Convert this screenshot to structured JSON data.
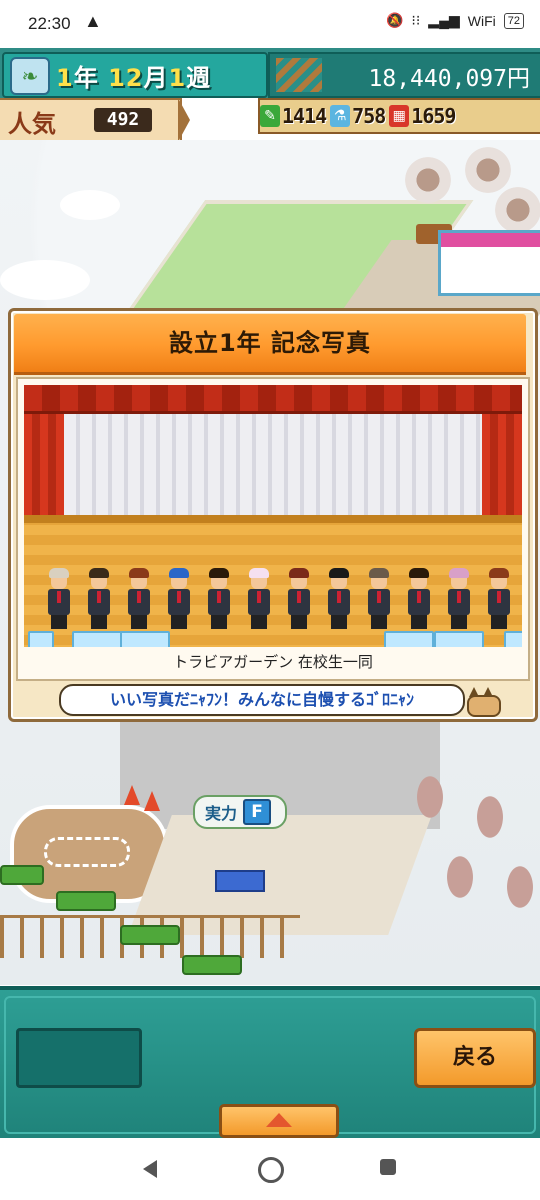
{
  "status_bar": {
    "time": "22:30",
    "warning_icon": "warning-triangle-icon",
    "network_label": "WiFi",
    "battery": "72"
  },
  "hud": {
    "date": {
      "year_num": "1",
      "year_unit": "年",
      "month_num": "12",
      "month_unit": "月",
      "week_num": "1",
      "week_unit": "週"
    },
    "money": "18,440,097円",
    "popularity_label": "人気",
    "popularity_value": "492",
    "resources": [
      {
        "icon": "pencil-icon",
        "value": "1414",
        "color": "#3aa83a"
      },
      {
        "icon": "flask-icon",
        "value": "758",
        "color": "#5bb5e0"
      },
      {
        "icon": "red-box-icon",
        "value": "1659",
        "color": "#d8362a"
      }
    ]
  },
  "map": {
    "skill_label": "実力",
    "skill_grade": "F"
  },
  "dialog": {
    "title": "設立1年 記念写真",
    "caption": "トラビアガーデン 在校生一同",
    "speech": "いい写真だﾆｬﾌﾝ！みんなに自慢するｺﾞﾛﾆｬﾝ",
    "people_hair_colors": [
      "#d9d0c0",
      "#3a2a1a",
      "#8a3a1a",
      "#2a66c8",
      "#2a1a0a",
      "#f5e0f0",
      "#7a2a1a",
      "#1a1a1a",
      "#6a5a4a",
      "#2a1a0a",
      "#d8a0c8",
      "#8a3a1a"
    ]
  },
  "bottom_panel": {
    "back_label": "戻る"
  }
}
